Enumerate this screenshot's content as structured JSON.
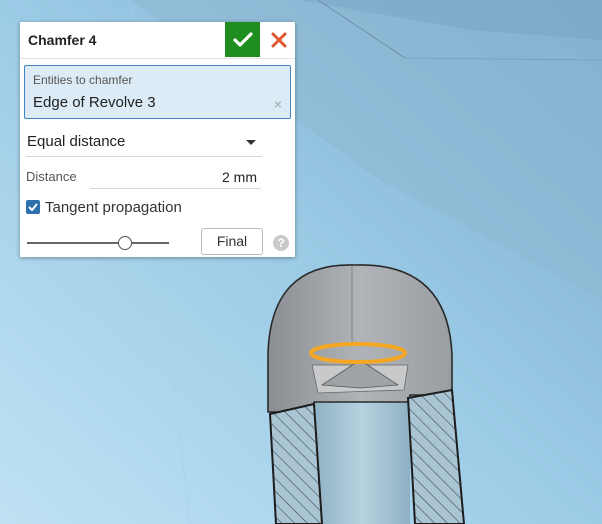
{
  "dialog": {
    "title": "Chamfer 4",
    "ok_icon": "checkmark-icon",
    "cancel_icon": "close-icon",
    "entities": {
      "label": "Entities to chamfer",
      "value": "Edge of Revolve 3",
      "clear_icon": "×"
    },
    "chamfer_type": {
      "value": "Equal distance"
    },
    "distance": {
      "label": "Distance",
      "value": "2 mm"
    },
    "tangent_propagation": {
      "label": "Tangent propagation",
      "checked": true
    },
    "slider": {
      "level": 0.69
    },
    "final_label": "Final",
    "help_icon": "?"
  },
  "colors": {
    "accept": "#1e8e1e",
    "cancel": "#e0562e",
    "highlight_edge": "#f5a623",
    "selection_blue": "#3f88c5"
  }
}
